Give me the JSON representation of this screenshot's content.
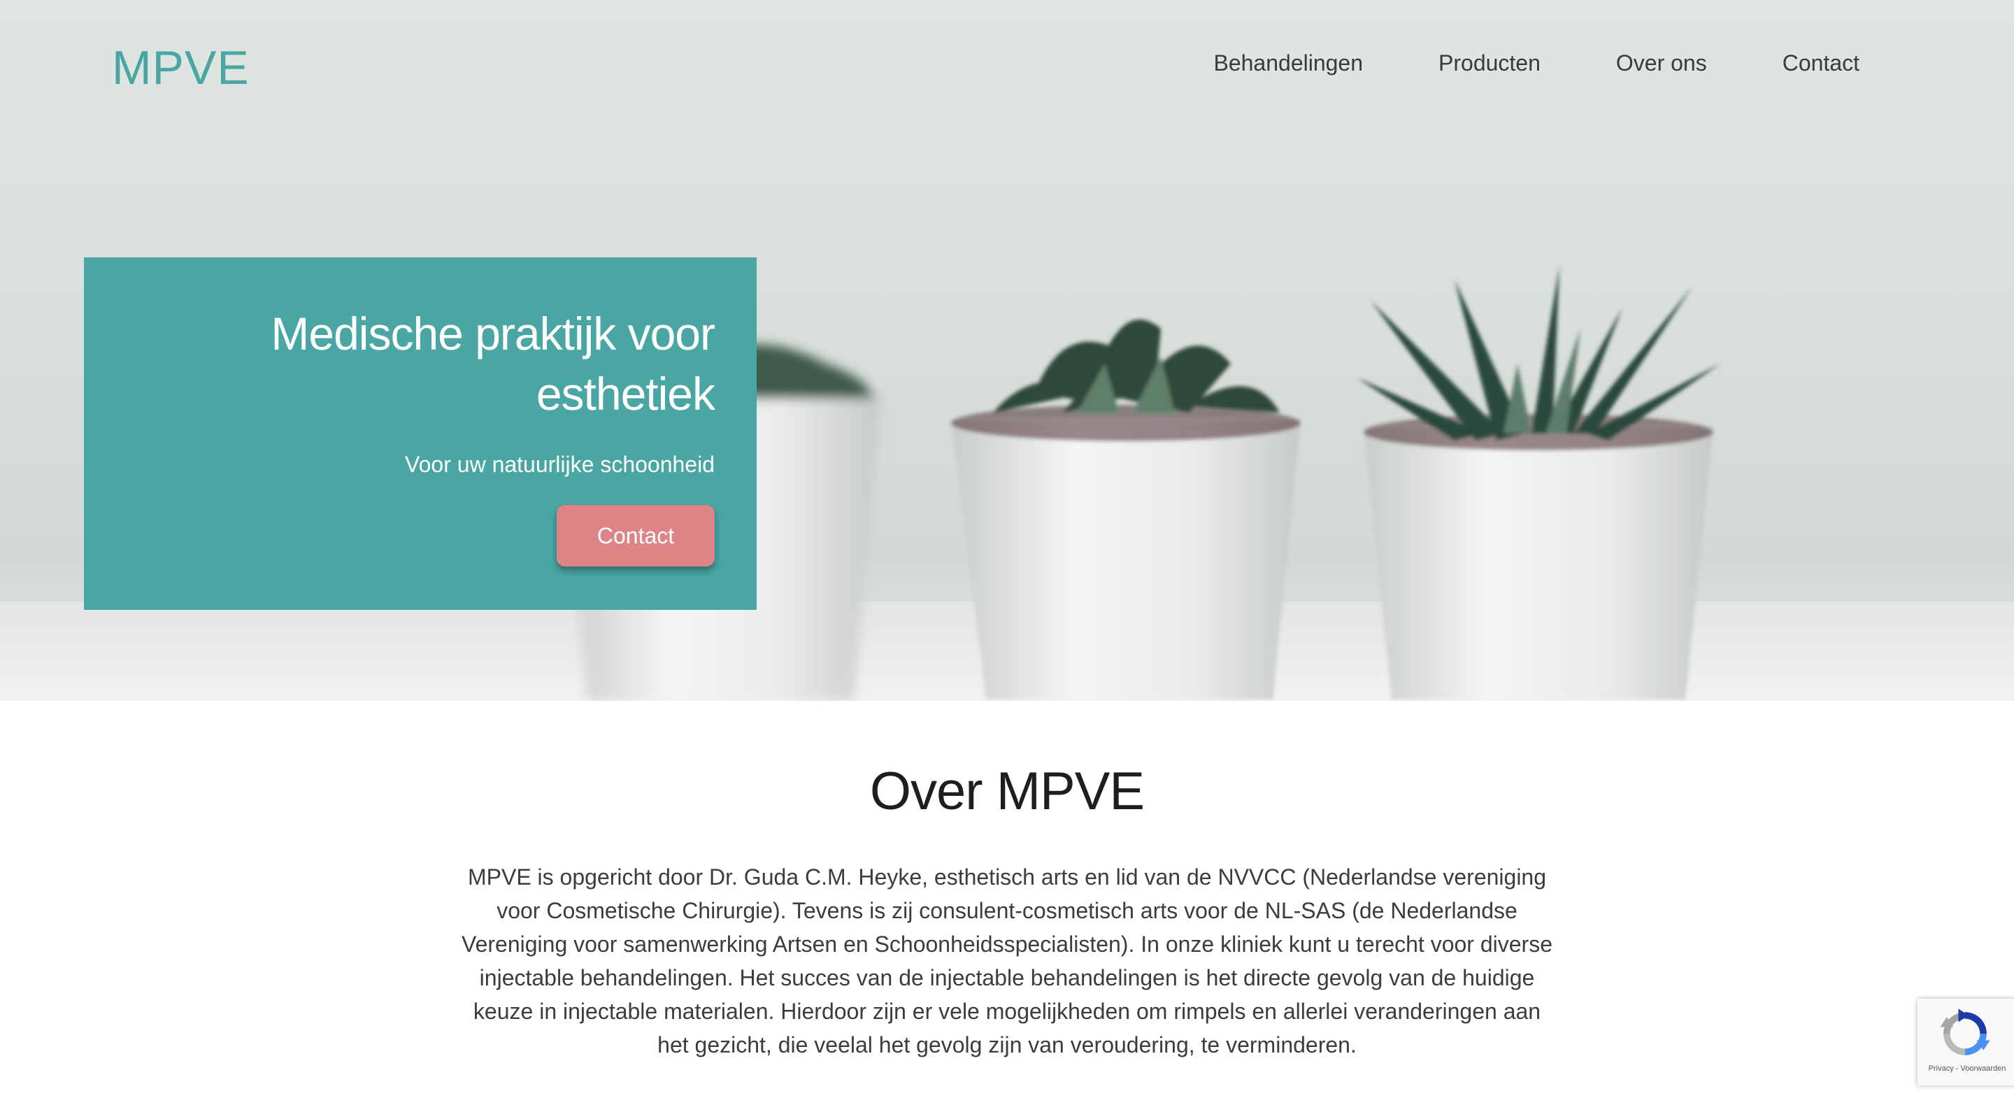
{
  "header": {
    "logo": "MPVE",
    "nav": [
      "Behandelingen",
      "Producten",
      "Over ons",
      "Contact"
    ]
  },
  "hero": {
    "title": "Medische praktijk voor esthetiek",
    "subtitle": "Voor uw natuurlijke schoonheid",
    "button_label": "Contact"
  },
  "about": {
    "title": "Over MPVE",
    "text": "MPVE is opgericht door Dr. Guda C.M. Heyke, esthetisch arts en lid van de NVVCC (Nederlandse vereniging voor Cosmetische Chirurgie). Tevens is zij consulent-cosmetisch arts voor de NL-SAS (de Nederlandse Vereniging voor samenwerking Artsen en Schoonheidsspecialisten). In onze kliniek kunt u terecht voor diverse injectable behandelingen. Het succes van de injectable behandelingen is het directe gevolg van de huidige keuze in injectable materialen. Hierdoor zijn er vele mogelijkheden om rimpels en allerlei veranderingen aan het gezicht, die veelal het gevolg zijn van veroudering, te verminderen."
  },
  "recaptcha": {
    "links": "Privacy - Voorwaarden"
  },
  "colors": {
    "accent": "#4aa6a3",
    "button": "#dc8486"
  }
}
